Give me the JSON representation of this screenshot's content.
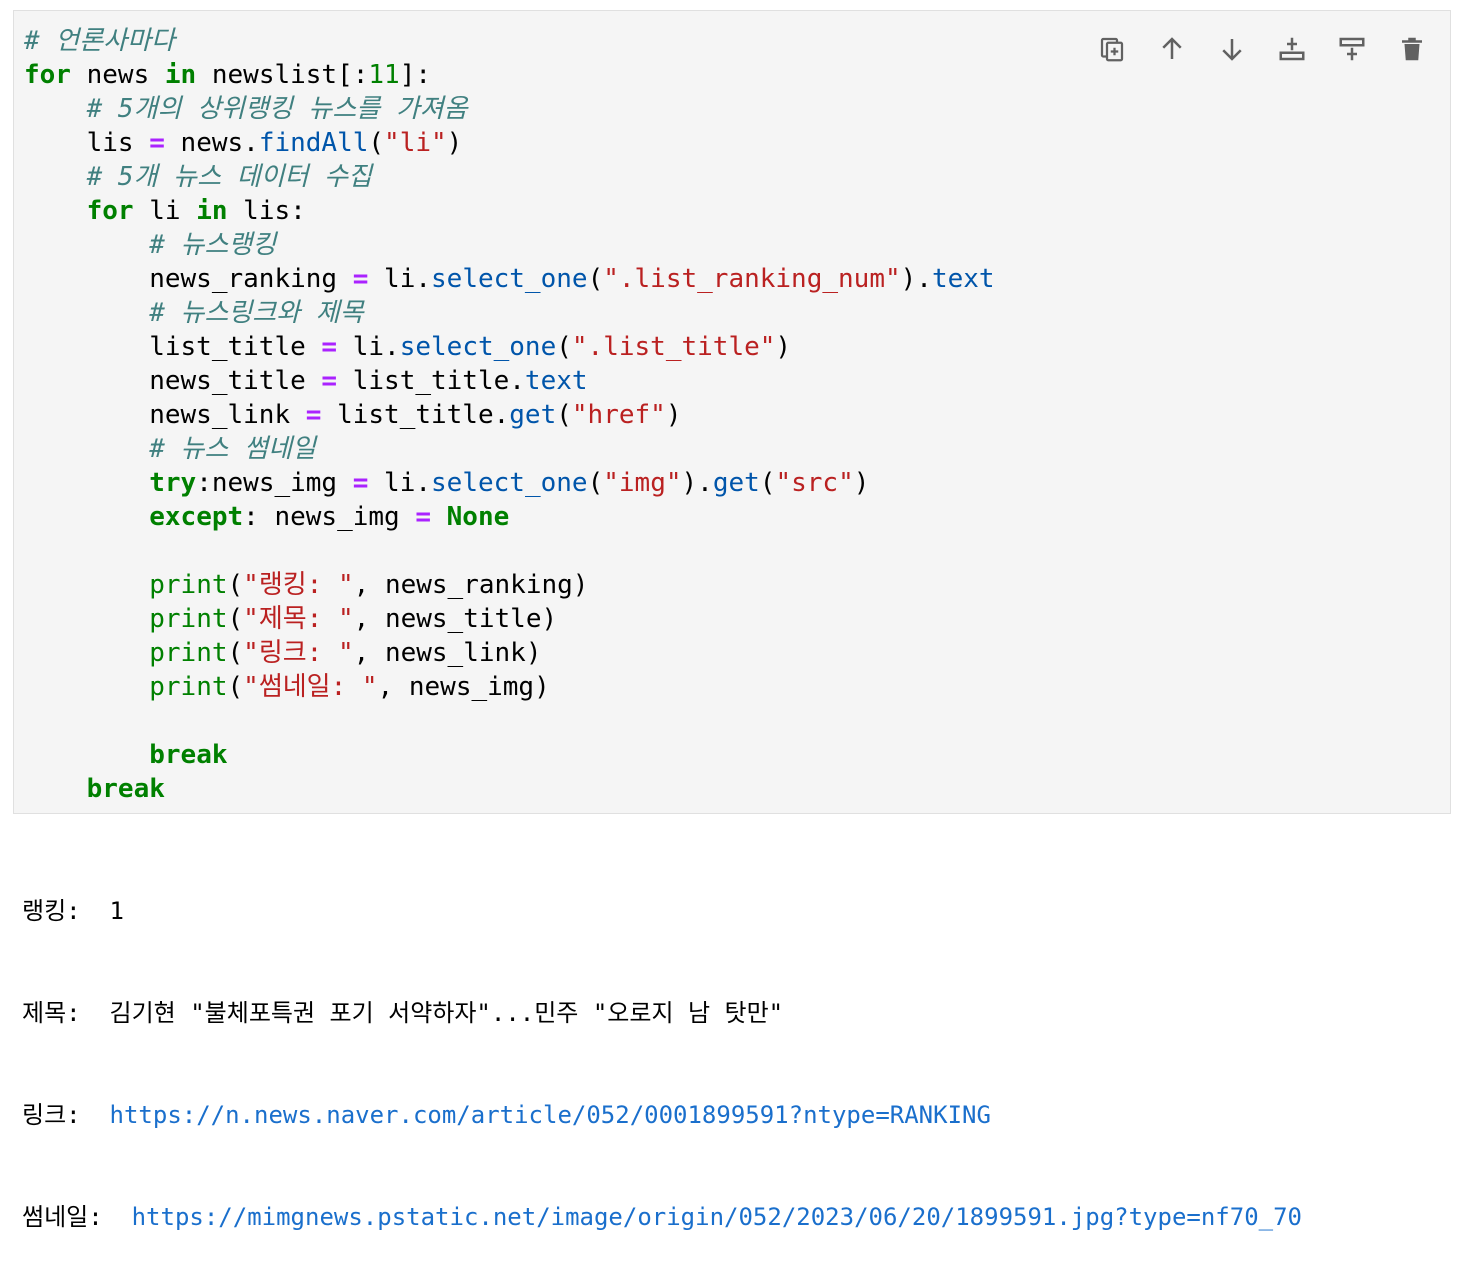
{
  "cell": {
    "code_lines": [
      [
        {
          "t": "# 언론사마다",
          "c": "cm"
        }
      ],
      [
        {
          "t": "for",
          "c": "kw"
        },
        {
          "t": " news "
        },
        {
          "t": "in",
          "c": "kw"
        },
        {
          "t": " newslist[:"
        },
        {
          "t": "11",
          "c": "nm"
        },
        {
          "t": "]:"
        }
      ],
      [
        {
          "t": "    "
        },
        {
          "t": "# 5개의 상위랭킹 뉴스를 가져옴",
          "c": "cm"
        }
      ],
      [
        {
          "t": "    lis "
        },
        {
          "t": "=",
          "c": "op"
        },
        {
          "t": " news."
        },
        {
          "t": "findAll",
          "c": "fn"
        },
        {
          "t": "("
        },
        {
          "t": "\"li\"",
          "c": "st"
        },
        {
          "t": ")"
        }
      ],
      [
        {
          "t": "    "
        },
        {
          "t": "# 5개 뉴스 데이터 수집",
          "c": "cm"
        }
      ],
      [
        {
          "t": "    "
        },
        {
          "t": "for",
          "c": "kw"
        },
        {
          "t": " li "
        },
        {
          "t": "in",
          "c": "kw"
        },
        {
          "t": " lis:"
        }
      ],
      [
        {
          "t": "        "
        },
        {
          "t": "# 뉴스랭킹",
          "c": "cm"
        }
      ],
      [
        {
          "t": "        news_ranking "
        },
        {
          "t": "=",
          "c": "op"
        },
        {
          "t": " li."
        },
        {
          "t": "select_one",
          "c": "fn"
        },
        {
          "t": "("
        },
        {
          "t": "\".list_ranking_num\"",
          "c": "st"
        },
        {
          "t": ")."
        },
        {
          "t": "text",
          "c": "fn"
        }
      ],
      [
        {
          "t": "        "
        },
        {
          "t": "# 뉴스링크와 제목",
          "c": "cm"
        }
      ],
      [
        {
          "t": "        list_title "
        },
        {
          "t": "=",
          "c": "op"
        },
        {
          "t": " li."
        },
        {
          "t": "select_one",
          "c": "fn"
        },
        {
          "t": "("
        },
        {
          "t": "\".list_title\"",
          "c": "st"
        },
        {
          "t": ")"
        }
      ],
      [
        {
          "t": "        news_title "
        },
        {
          "t": "=",
          "c": "op"
        },
        {
          "t": " list_title."
        },
        {
          "t": "text",
          "c": "fn"
        }
      ],
      [
        {
          "t": "        news_link "
        },
        {
          "t": "=",
          "c": "op"
        },
        {
          "t": " list_title."
        },
        {
          "t": "get",
          "c": "fn"
        },
        {
          "t": "("
        },
        {
          "t": "\"href\"",
          "c": "st"
        },
        {
          "t": ")"
        }
      ],
      [
        {
          "t": "        "
        },
        {
          "t": "# 뉴스 썸네일",
          "c": "cm"
        }
      ],
      [
        {
          "t": "        "
        },
        {
          "t": "try",
          "c": "kw"
        },
        {
          "t": ":news_img "
        },
        {
          "t": "=",
          "c": "op"
        },
        {
          "t": " li."
        },
        {
          "t": "select_one",
          "c": "fn"
        },
        {
          "t": "("
        },
        {
          "t": "\"img\"",
          "c": "st"
        },
        {
          "t": ")."
        },
        {
          "t": "get",
          "c": "fn"
        },
        {
          "t": "("
        },
        {
          "t": "\"src\"",
          "c": "st"
        },
        {
          "t": ")"
        }
      ],
      [
        {
          "t": "        "
        },
        {
          "t": "except",
          "c": "kw"
        },
        {
          "t": ": news_img "
        },
        {
          "t": "=",
          "c": "op"
        },
        {
          "t": " "
        },
        {
          "t": "None",
          "c": "kw"
        }
      ],
      [],
      [
        {
          "t": "        "
        },
        {
          "t": "print",
          "c": "bi"
        },
        {
          "t": "("
        },
        {
          "t": "\"랭킹: \"",
          "c": "st"
        },
        {
          "t": ", news_ranking)"
        }
      ],
      [
        {
          "t": "        "
        },
        {
          "t": "print",
          "c": "bi"
        },
        {
          "t": "("
        },
        {
          "t": "\"제목: \"",
          "c": "st"
        },
        {
          "t": ", news_title)"
        }
      ],
      [
        {
          "t": "        "
        },
        {
          "t": "print",
          "c": "bi"
        },
        {
          "t": "("
        },
        {
          "t": "\"링크: \"",
          "c": "st"
        },
        {
          "t": ", news_link)"
        }
      ],
      [
        {
          "t": "        "
        },
        {
          "t": "print",
          "c": "bi"
        },
        {
          "t": "("
        },
        {
          "t": "\"썸네일: \"",
          "c": "st"
        },
        {
          "t": ", news_img)"
        }
      ],
      [],
      [
        {
          "t": "        "
        },
        {
          "t": "break",
          "c": "kw"
        }
      ],
      [
        {
          "t": "    "
        },
        {
          "t": "break",
          "c": "kw"
        }
      ]
    ]
  },
  "toolbar": {
    "buttons": [
      {
        "name": "duplicate-cell-icon"
      },
      {
        "name": "move-up-icon"
      },
      {
        "name": "move-down-icon"
      },
      {
        "name": "insert-above-icon"
      },
      {
        "name": "insert-below-icon"
      },
      {
        "name": "delete-cell-icon"
      }
    ],
    "icon_color": "#616161"
  },
  "output": {
    "ranking_label": "랭킹:",
    "ranking_value": "1",
    "title_label": "제목:",
    "title_value": "김기현 \"불체포특권 포기 서약하자\"...민주 \"오로지 남 탓만\"",
    "link_label": "링크:",
    "link_value": "https://n.news.naver.com/article/052/0001899591?ntype=RANKING",
    "thumb_label": "썸네일:",
    "thumb_value": "https://mimgnews.pstatic.net/image/origin/052/2023/06/20/1899591.jpg?type=nf70_70"
  },
  "colors": {
    "comment": "#408080",
    "keyword": "#008000",
    "operator": "#aa22ff",
    "function": "#0055aa",
    "string": "#ba2121",
    "link": "#1a6fcc",
    "cell_bg": "#f5f5f5"
  }
}
